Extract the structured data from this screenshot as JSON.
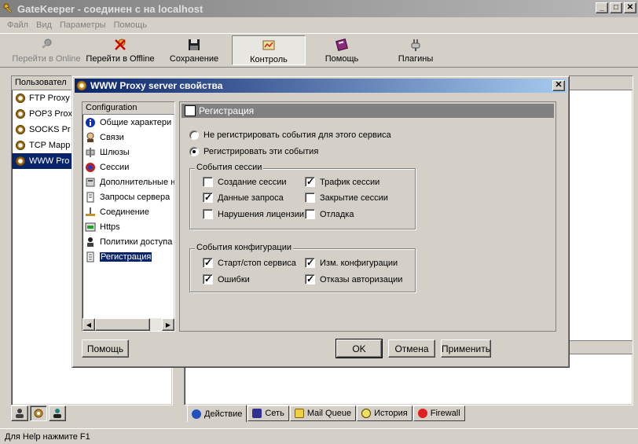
{
  "window": {
    "title": "GateKeeper - соединен с на localhost",
    "min": "_",
    "max": "□",
    "close": "✕"
  },
  "menu": [
    "Файл",
    "Вид",
    "Параметры",
    "Помощь"
  ],
  "toolbar": {
    "go_online": "Перейти в Online",
    "go_offline": "Перейти в Offline",
    "save": "Сохранение",
    "control": "Контроль",
    "help": "Помощь",
    "plugins": "Плагины"
  },
  "left_panel": {
    "header": "Пользовател",
    "items": [
      "FTP Proxy",
      "POP3 Prox",
      "SOCKS Pr",
      "TCP Mapp",
      "WWW Pro"
    ]
  },
  "bottom_tabs": [
    "Действие",
    "Сеть",
    "Mail Queue",
    "История",
    "Firewall"
  ],
  "status": "Для Help нажмите F1",
  "dialog": {
    "title": "WWW Proxy server свойства",
    "close": "✕",
    "tree_header": "Configuration",
    "tree_items": [
      "Общие характери",
      "Связи",
      "Шлюзы",
      "Сессии",
      "Дополнительные н",
      "Запросы сервера",
      "Соединение",
      "Https",
      "Политики доступа",
      "Регистрация"
    ],
    "page_title": "Регистрация",
    "radio_no": "Не регистрировать события для этого сервиса",
    "radio_yes": "Регистрировать эти события",
    "session_group": "События сессии",
    "session_events": {
      "create": "Создание сессии",
      "traffic": "Трафик сессии",
      "request_data": "Данные запроса",
      "close": "Закрытие сессии",
      "license": "Нарушения лицензии",
      "debug": "Отладка"
    },
    "config_group": "События конфигурации",
    "config_events": {
      "startstop": "Старт/стоп сервиса",
      "change": "Изм. конфигурации",
      "errors": "Ошибки",
      "auth": "Отказы авторизации"
    },
    "buttons": {
      "help": "Помощь",
      "ok": "OK",
      "cancel": "Отмена",
      "apply": "Применить"
    }
  }
}
